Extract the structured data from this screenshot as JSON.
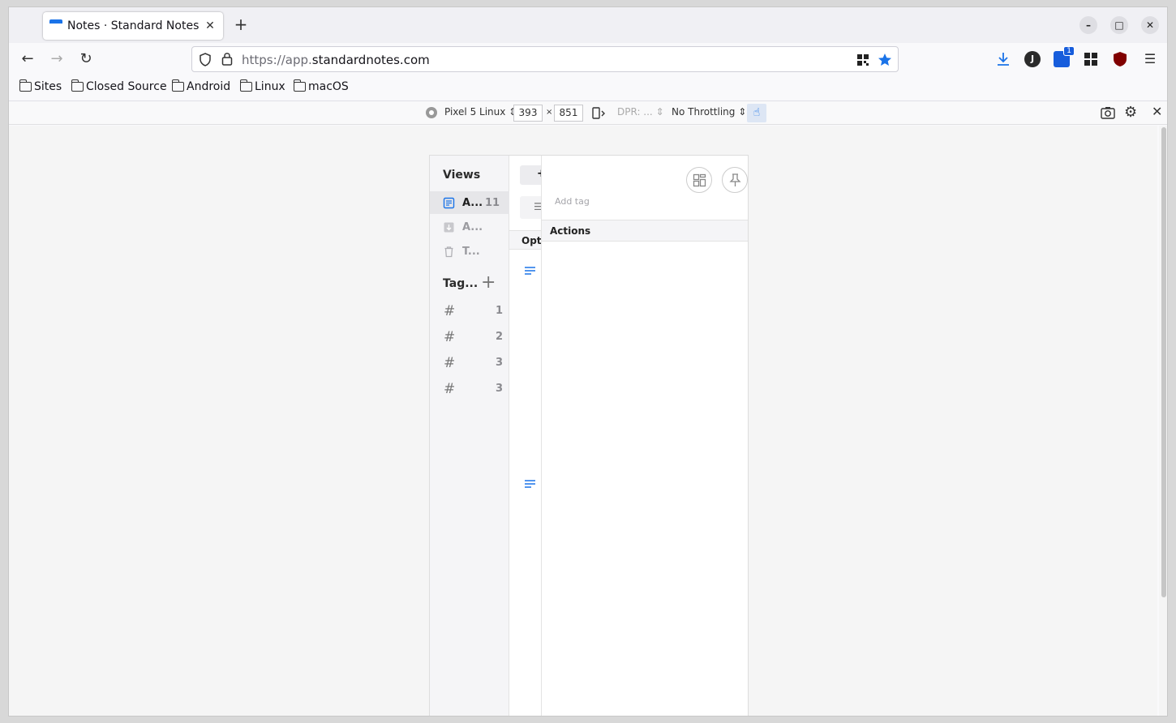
{
  "browser": {
    "tab_title": "Notes · Standard Notes",
    "url_host": "https://app.",
    "url_domain": "standardnotes.com",
    "bookmarks": [
      "Sites",
      "Closed Source",
      "Android",
      "Linux",
      "macOS"
    ],
    "extension_badge": "1",
    "profile_letter": "J"
  },
  "rdm": {
    "device": "Pixel 5 Linux",
    "width": "393",
    "times": "×",
    "height": "851",
    "dpr": "DPR: ...",
    "throttling": "No Throttling"
  },
  "app": {
    "views_title": "Views",
    "views": [
      {
        "label": "A...",
        "count": "11"
      },
      {
        "label": "A...",
        "count": ""
      },
      {
        "label": "T...",
        "count": ""
      }
    ],
    "tags_title": "Tag...",
    "tags": [
      {
        "count": "1"
      },
      {
        "count": "2"
      },
      {
        "count": "3"
      },
      {
        "count": "3"
      }
    ],
    "list_options_label": "Opti",
    "add_tag_placeholder": "Add tag",
    "actions_label": "Actions"
  }
}
